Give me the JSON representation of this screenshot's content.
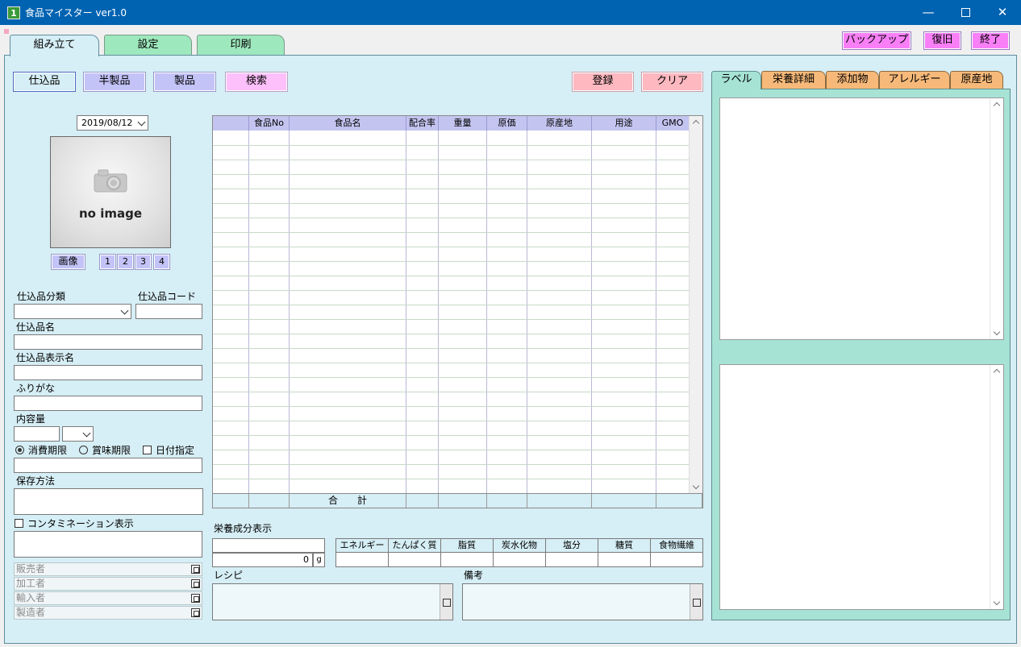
{
  "window": {
    "title": "食品マイスター ver1.0",
    "icon_text": "1",
    "controls": [
      "minimize-icon",
      "maximize-icon",
      "close-icon"
    ]
  },
  "main_tabs": [
    {
      "label": "組み立て",
      "active": true
    },
    {
      "label": "設定",
      "active": false
    },
    {
      "label": "印刷",
      "active": false
    }
  ],
  "top_buttons": {
    "backup": "バックアップ",
    "restore": "復旧",
    "exit": "終了"
  },
  "mode_buttons": {
    "shikomi": "仕込品",
    "hanseihin": "半製品",
    "seihin": "製品",
    "search": "検索",
    "register": "登録",
    "clear": "クリア"
  },
  "date": "2019/08/12",
  "image": {
    "placeholder": "no image",
    "button": "画像",
    "numbers": [
      "1",
      "2",
      "3",
      "4"
    ]
  },
  "form": {
    "category_label": "仕込品分類",
    "code_label": "仕込品コード",
    "name_label": "仕込品名",
    "display_name_label": "仕込品表示名",
    "furigana_label": "ふりがな",
    "content_label": "内容量",
    "expiry_options": [
      {
        "label": "消費期限",
        "selected": true
      },
      {
        "label": "賞味期限",
        "selected": false
      }
    ],
    "date_spec_label": "日付指定",
    "storage_label": "保存方法",
    "contamination_label": "コンタミネーション表示",
    "parties": [
      "販売者",
      "加工者",
      "輸入者",
      "製造者"
    ]
  },
  "grid": {
    "columns": [
      "",
      "食品No",
      "食品名",
      "配合率",
      "重量",
      "原価",
      "原産地",
      "用途",
      "GMO"
    ],
    "row_count": 25,
    "footer_total": "合　　計"
  },
  "nutrition": {
    "title": "栄養成分表示",
    "weight_value": "0",
    "weight_unit": "g",
    "columns": [
      "エネルギー",
      "たんぱく質",
      "脂質",
      "炭水化物",
      "塩分",
      "糖質",
      "食物繊維"
    ]
  },
  "recipe_label": "レシピ",
  "notes_label": "備考",
  "right_tabs": [
    {
      "label": "ラベル",
      "active": true
    },
    {
      "label": "栄養詳細",
      "active": false
    },
    {
      "label": "添加物",
      "active": false
    },
    {
      "label": "アレルギー",
      "active": false
    },
    {
      "label": "原産地",
      "active": false
    }
  ],
  "colors": {
    "titlebar": "#0063b1",
    "panel_bg": "#d6eef5",
    "tab_green": "#9ee8bd",
    "magenta_button": "#f97ff7",
    "blue_button": "#c3c3f8",
    "pink_button": "#fdb8c0",
    "right_panel": "#a6e3d5",
    "orange_tab": "#f7b979"
  }
}
